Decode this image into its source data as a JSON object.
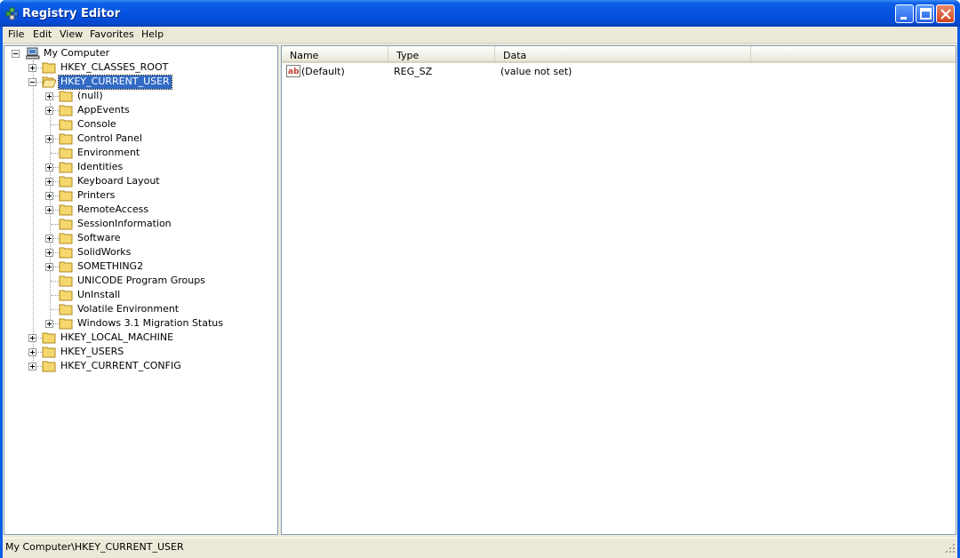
{
  "window": {
    "title": "Registry Editor",
    "colors": {
      "titlebar": "#0553e1",
      "selection": "#316ac5",
      "client": "#ece9d8"
    }
  },
  "menu": [
    "File",
    "Edit",
    "View",
    "Favorites",
    "Help"
  ],
  "tree": {
    "root": "My Computer",
    "hives": {
      "classes_root": "HKEY_CLASSES_ROOT",
      "current_user": "HKEY_CURRENT_USER",
      "local_machine": "HKEY_LOCAL_MACHINE",
      "users": "HKEY_USERS",
      "current_config": "HKEY_CURRENT_CONFIG"
    },
    "current_user_children": [
      "(null)",
      "AppEvents",
      "Console",
      "Control Panel",
      "Environment",
      "Identities",
      "Keyboard Layout",
      "Printers",
      "RemoteAccess",
      "SessionInformation",
      "Software",
      "SolidWorks",
      "SOMETHING2",
      "UNICODE Program Groups",
      "UnInstall",
      "Volatile Environment",
      "Windows 3.1 Migration Status"
    ],
    "selected": "HKEY_CURRENT_USER"
  },
  "list": {
    "columns": {
      "name": "Name",
      "type": "Type",
      "data": "Data"
    },
    "rows": [
      {
        "icon": "string-value-icon",
        "name": "(Default)",
        "type": "REG_SZ",
        "data": "(value not set)"
      }
    ]
  },
  "status": {
    "path": "My Computer\\HKEY_CURRENT_USER"
  }
}
